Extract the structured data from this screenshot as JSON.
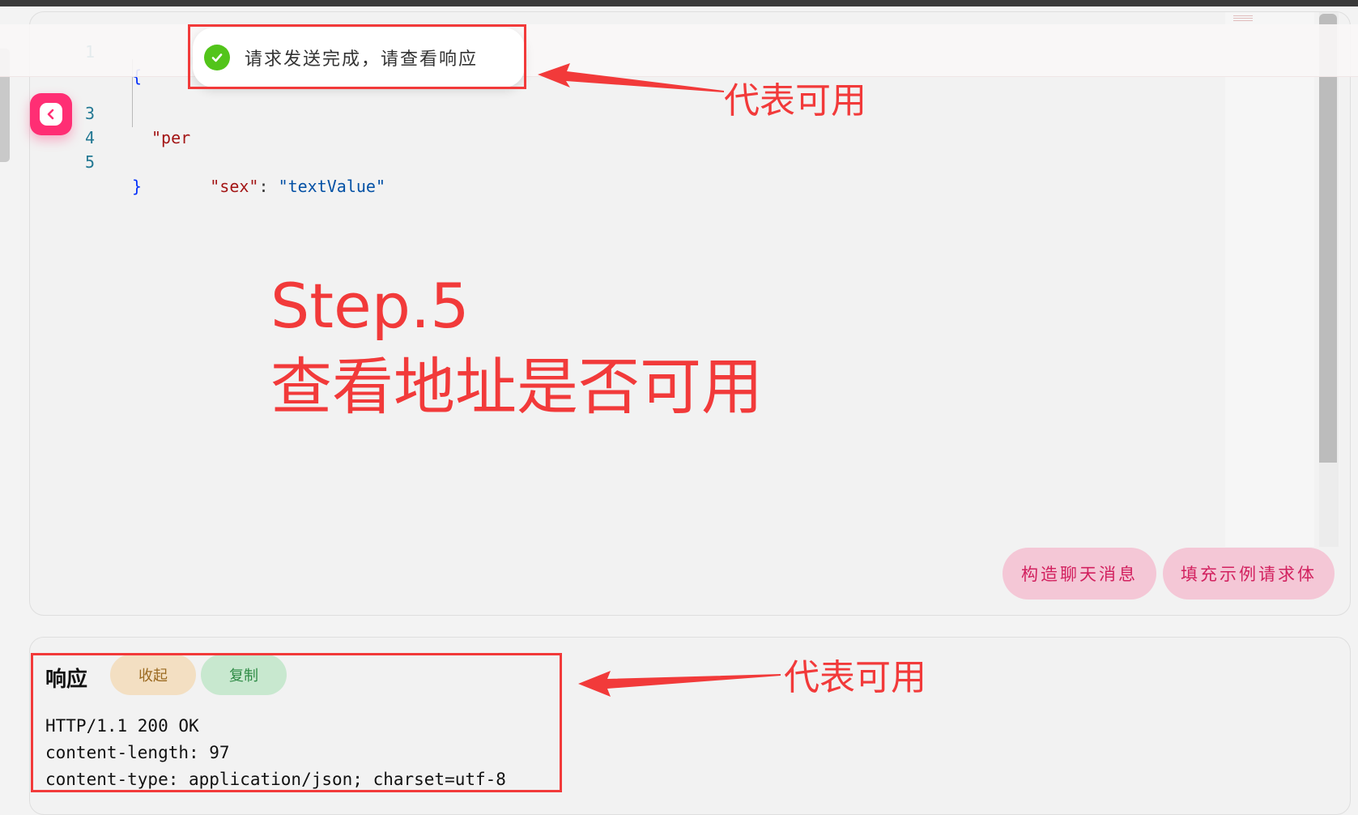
{
  "toast": {
    "message": "请求发送完成，请查看响应",
    "icon": "check-circle-icon"
  },
  "editor": {
    "lines": [
      {
        "num": "1",
        "text": "{"
      },
      {
        "num": "3",
        "text": "\"per"
      },
      {
        "num": "4",
        "key": "\"sex\"",
        "sep": ": ",
        "value": "\"textValue\""
      },
      {
        "num": "5",
        "text": "}"
      }
    ]
  },
  "annotations": {
    "top_arrow_label": "代表可用",
    "step_title": "Step.5",
    "step_subtitle": "查看地址是否可用",
    "bottom_arrow_label": "代表可用"
  },
  "actions": {
    "build_chat_label": "构造聊天消息",
    "fill_example_label": "填充示例请求体"
  },
  "response": {
    "title": "响应",
    "collapse_label": "收起",
    "copy_label": "复制",
    "lines": [
      "HTTP/1.1 200 OK",
      "content-length: 97",
      "content-type: application/json; charset=utf-8"
    ]
  },
  "colors": {
    "accent_pink": "#ff2e74",
    "annotation_red": "#f23a3a",
    "success_green": "#52c41a"
  }
}
